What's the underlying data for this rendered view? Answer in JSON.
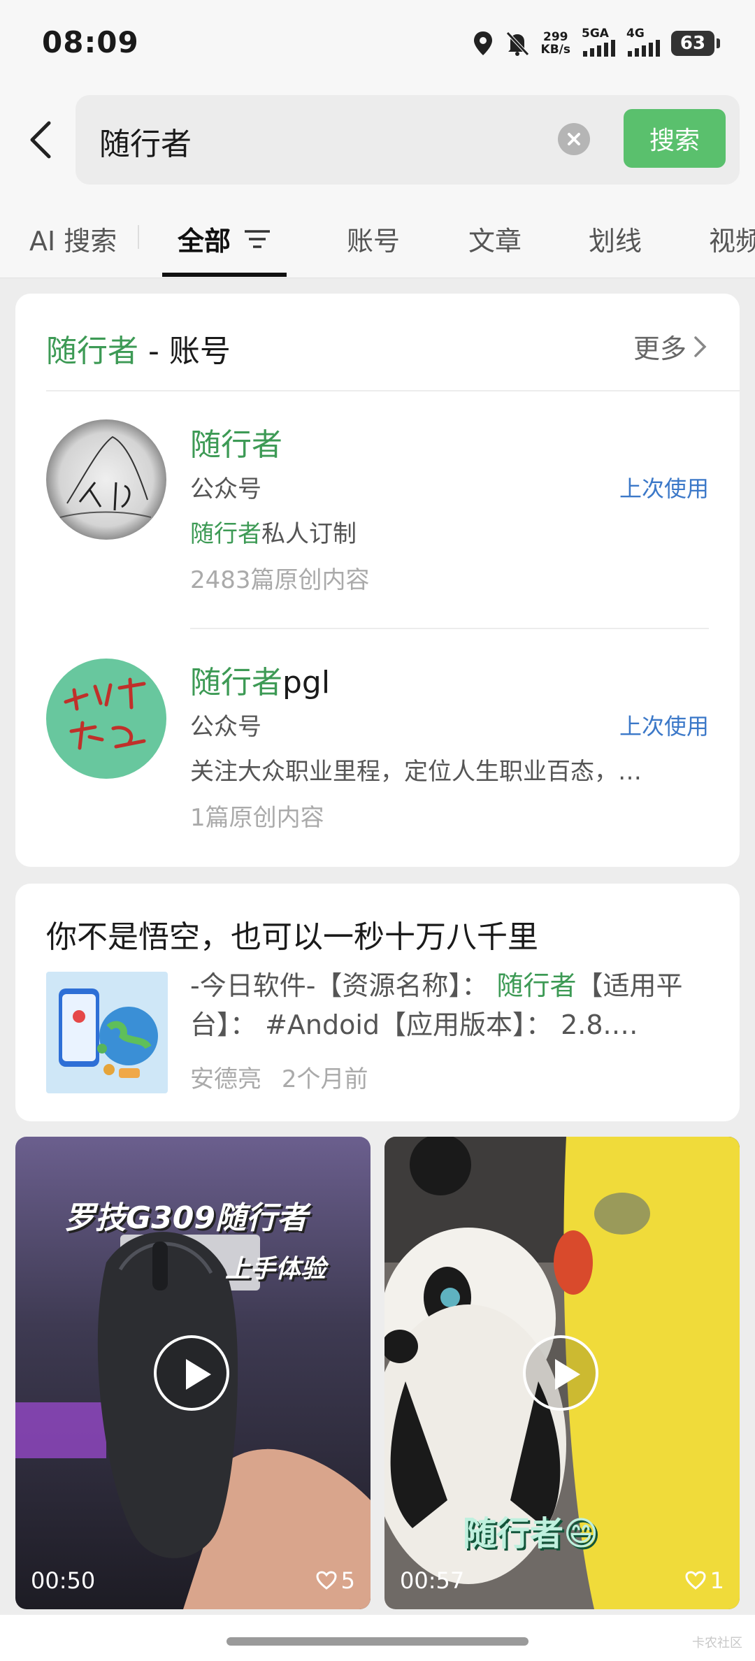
{
  "status_bar": {
    "time": "08:09",
    "net_speed_value": "299",
    "net_speed_unit": "KB/s",
    "network_1": "5GA",
    "network_2": "4G",
    "battery": "63",
    "icons": [
      "location-icon",
      "bell-off-icon",
      "signal-icon",
      "battery-icon"
    ]
  },
  "search": {
    "query": "随行者",
    "button_label": "搜索"
  },
  "tabs": [
    {
      "label": "AI 搜索"
    },
    {
      "label": "全部"
    },
    {
      "label": "账号"
    },
    {
      "label": "文章"
    },
    {
      "label": "划线"
    },
    {
      "label": "视频"
    }
  ],
  "accounts_card": {
    "title_keyword": "随行者",
    "title_suffix": " - 账号",
    "more_label": "更多",
    "items": [
      {
        "name_highlight": "随行者",
        "name_rest": "",
        "type": "公众号",
        "last_used": "上次使用",
        "desc_highlight": "随行者",
        "desc_rest": "私人订制",
        "count": "2483篇原创内容"
      },
      {
        "name_highlight": "随行者",
        "name_rest": "pgl",
        "type": "公众号",
        "last_used": "上次使用",
        "desc_highlight": "",
        "desc_rest": "关注大众职业里程，定位人生职业百态，…",
        "count": "1篇原创内容"
      }
    ]
  },
  "article_card": {
    "title": "你不是悟空，也可以一秒十万八千里",
    "snippet_before": "-今日软件-【资源名称】： ",
    "snippet_highlight": "随行者",
    "snippet_after": "【适用平台】： #Andoid【应用版本】： 2.8.…",
    "author": "安德亮",
    "time": "2个月前"
  },
  "videos": [
    {
      "caption": "罗技G309随行者",
      "caption_sub": "上手体验",
      "duration": "00:50",
      "likes": "5"
    },
    {
      "caption": "随行者😄",
      "duration": "00:57",
      "likes": "1"
    }
  ],
  "watermark": "卡农社区",
  "colors": {
    "accent_green": "#5ac06d",
    "highlight_green": "#3d9a55",
    "link_blue": "#3b78c8"
  }
}
